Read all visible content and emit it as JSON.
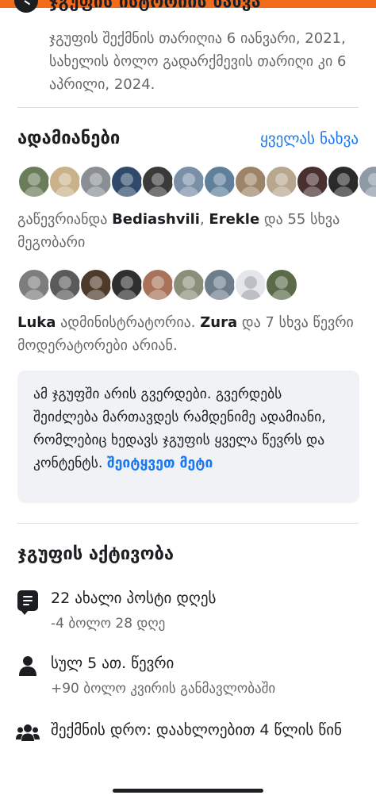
{
  "history": {
    "title": "ჯგუფის ისტორიის ნახვა",
    "description": "ჯგუფის შექმნის თარიღია 6 იანვარი, 2021, სახელის ბოლო გადარქმევის თარიღი კი 6 აპრილი, 2024."
  },
  "people": {
    "title": "ადამიანები",
    "see_all": "ყველას ნახვა",
    "member_avatars": [
      "#6b7c5a",
      "#c9b28a",
      "#8a8f96",
      "#2f4a6b",
      "#3a3a3a",
      "#7a8fa8",
      "#5f7f9a",
      "#9c8468",
      "#b8a78f",
      "#4a2f2f",
      "#2a2a2a",
      "#8e9aa6"
    ],
    "joined_prefix": "გაწევრიანდა ",
    "joined_name_1": "Bediashvili",
    "joined_sep": ", ",
    "joined_name_2": "Erekle",
    "joined_suffix": " და 55 სხვა მეგობარი",
    "admin_avatars": [
      "#7d7d7d",
      "#5a5a5a",
      "#4f3a2a",
      "#2f2f2f",
      "#a8735a",
      "#8b8f7a",
      "#6e7d8c",
      "default",
      "#5a6b4a"
    ],
    "admin_name_1": "Luka",
    "admin_text": " ადმინისტრატორია. ",
    "admin_name_2": "Zura",
    "admin_suffix": " და 7 სხვა წევრი მოდერატორები არიან."
  },
  "info_box": {
    "text": "ამ ჯგუფში არის გვერდები. გვერდებს შეიძლება მართავდეს რამდენიმე ადამიანი, რომლებიც ხედავს ჯგუფის ყველა წევრს და კონტენტს. ",
    "learn_more": "შეიტყვეთ მეტი"
  },
  "activity": {
    "title": "ჯგუფის აქტივობა",
    "posts_primary": "22 ახალი პოსტი დღეს",
    "posts_secondary": "-4 ბოლო 28 დღე",
    "members_primary": "სულ 5 ათ. წევრი",
    "members_secondary": "+90 ბოლო კვირის განმავლობაში",
    "created_primary": "შექმნის დრო: დაახლოებით 4 წლის წინ"
  },
  "colors": {
    "accent": "#1877f2",
    "top_bar": "#f26b1d",
    "info_box_bg": "#f0f2f5"
  }
}
